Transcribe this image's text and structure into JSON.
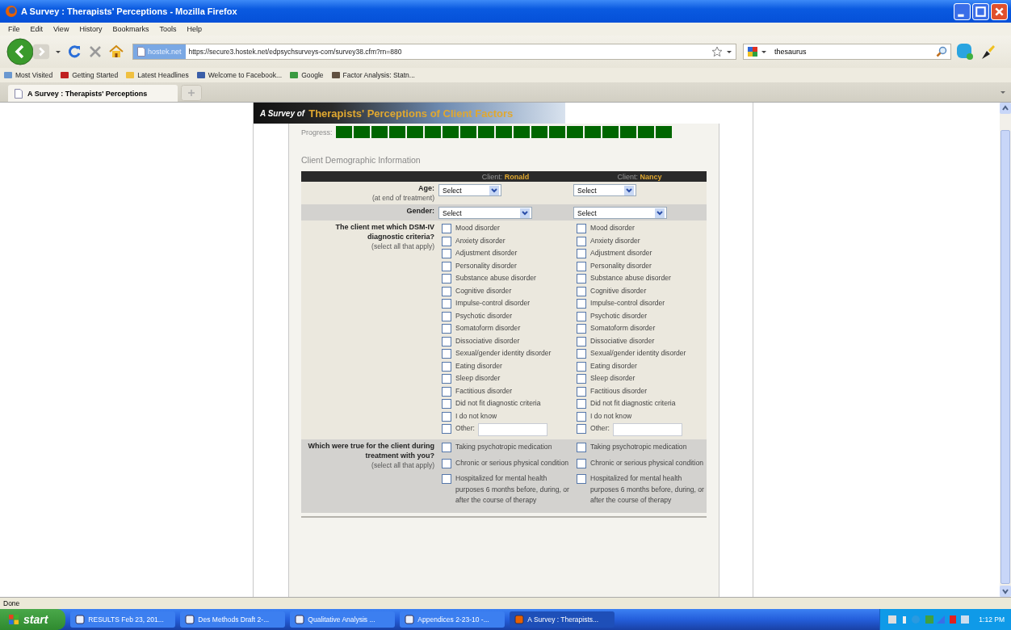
{
  "window": {
    "title": "A Survey : Therapists' Perceptions - Mozilla Firefox"
  },
  "menu": [
    "File",
    "Edit",
    "View",
    "History",
    "Bookmarks",
    "Tools",
    "Help"
  ],
  "address_bar": {
    "site": "hostek.net",
    "url": "https://secure3.hostek.net/edpsychsurveys-com/survey38.cfm?rn=880"
  },
  "search": {
    "value": "thesaurus"
  },
  "bookmarks": [
    "Most Visited",
    "Getting Started",
    "Latest Headlines",
    "Welcome to Facebook...",
    "Google",
    "Factor Analysis: Statn..."
  ],
  "tabs": [
    {
      "label": "A Survey : Therapists' Perceptions",
      "selected": true
    }
  ],
  "survey": {
    "title_prefix": "A Survey of",
    "title": "Therapists' Perceptions of Client Factors",
    "progress": {
      "label": "Progress:",
      "level": 1
    },
    "section": "Client Demographic Information",
    "questions": [
      {
        "label": "Age:",
        "hint": "(at end of treatment)"
      },
      {
        "label": "Gender:"
      },
      {
        "label": "The client met which DSM-IV diagnostic criteria?",
        "hint": "(select all that apply)"
      },
      {
        "label": "Which were true for the client during treatment with you?",
        "hint": "(select all that apply)"
      }
    ],
    "clients": [
      {
        "prefix": "Client:",
        "name": "Ronald",
        "age": "Select",
        "gender": "Select",
        "diagnoses": [
          {
            "label": "Mood disorder",
            "checked": false
          },
          {
            "label": "Anxiety disorder",
            "checked": false
          },
          {
            "label": "Adjustment disorder",
            "checked": false
          },
          {
            "label": "Personality disorder",
            "checked": false
          },
          {
            "label": "Substance abuse disorder",
            "checked": false
          },
          {
            "label": "Cognitive disorder",
            "checked": false
          },
          {
            "label": "Impulse-control disorder",
            "checked": false
          },
          {
            "label": "Psychotic disorder",
            "checked": false
          },
          {
            "label": "Somatoform disorder",
            "checked": false
          },
          {
            "label": "Dissociative disorder",
            "checked": false
          },
          {
            "label": "Sexual/gender identity disorder",
            "checked": false
          },
          {
            "label": "Eating disorder",
            "checked": false
          },
          {
            "label": "Sleep disorder",
            "checked": false
          },
          {
            "label": "Factitious disorder",
            "checked": false
          },
          {
            "label": "Did not fit diagnostic criteria",
            "checked": false
          },
          {
            "label": "I do not know",
            "checked": false
          }
        ],
        "other": {
          "label": "Other:",
          "checked": false
        },
        "conditions": [
          {
            "label": "Taking psychotropic medication",
            "checked": false
          },
          {
            "label": "Chronic or serious physical condition",
            "checked": false
          },
          {
            "label": "Hospitalized for mental health purposes 6 months before, during, or after the course of therapy",
            "checked": false
          }
        ]
      },
      {
        "prefix": "Client:",
        "name": "Nancy",
        "age": "Select",
        "gender": "Select",
        "diagnoses": [
          {
            "label": "Mood disorder",
            "checked": false
          },
          {
            "label": "Anxiety disorder",
            "checked": false
          },
          {
            "label": "Adjustment disorder",
            "checked": false
          },
          {
            "label": "Personality disorder",
            "checked": false
          },
          {
            "label": "Substance abuse disorder",
            "checked": false
          },
          {
            "label": "Cognitive disorder",
            "checked": false
          },
          {
            "label": "Impulse-control disorder",
            "checked": false
          },
          {
            "label": "Psychotic disorder",
            "checked": false
          },
          {
            "label": "Somatoform disorder",
            "checked": false
          },
          {
            "label": "Dissociative disorder",
            "checked": false
          },
          {
            "label": "Sexual/gender identity disorder",
            "checked": false
          },
          {
            "label": "Eating disorder",
            "checked": false
          },
          {
            "label": "Sleep disorder",
            "checked": false
          },
          {
            "label": "Factitious disorder",
            "checked": false
          },
          {
            "label": "Did not fit diagnostic criteria",
            "checked": false
          },
          {
            "label": "I do not know",
            "checked": false
          }
        ],
        "other": {
          "label": "Other:",
          "checked": false
        },
        "conditions": [
          {
            "label": "Taking psychotropic medication",
            "checked": false
          },
          {
            "label": "Chronic or serious physical condition",
            "checked": false
          },
          {
            "label": "Hospitalized for mental health purposes 6 months before, during, or after the course of therapy",
            "checked": false
          }
        ]
      }
    ]
  },
  "status_bar": "Done",
  "taskbar": {
    "start": "start",
    "items": [
      {
        "label": "RESULTS Feb 23, 201...",
        "selected": false
      },
      {
        "label": "Des Methods Draft 2-...",
        "selected": false
      },
      {
        "label": "Qualitative Analysis ...",
        "selected": false
      },
      {
        "label": "Appendices 2-23-10 -...",
        "selected": false
      },
      {
        "label": "A Survey : Therapists...",
        "selected": true
      }
    ],
    "clock": "1:12 PM"
  }
}
